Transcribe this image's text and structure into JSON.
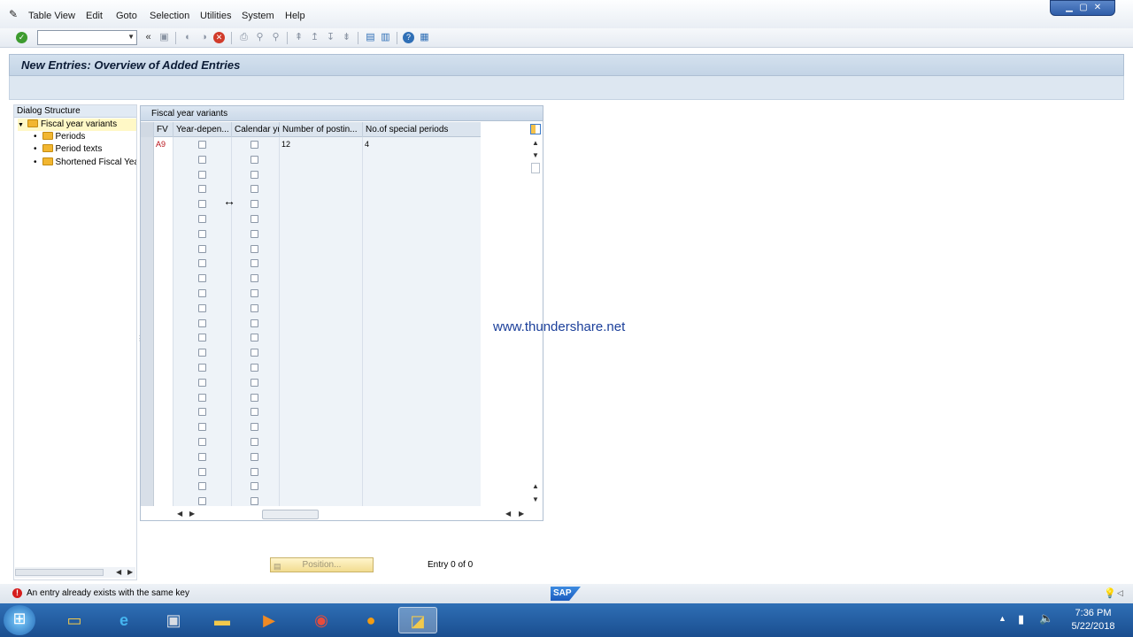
{
  "menu": {
    "items": [
      "Table View",
      "Edit",
      "Goto",
      "Selection",
      "Utilities",
      "System",
      "Help"
    ]
  },
  "title": "New Entries: Overview of Added Entries",
  "dialog_structure": {
    "header": "Dialog Structure",
    "nodes": [
      {
        "label": "Fiscal year variants",
        "selected": true
      },
      {
        "label": "Periods"
      },
      {
        "label": "Period texts"
      },
      {
        "label": "Shortened Fiscal Yea"
      }
    ]
  },
  "table": {
    "title": "Fiscal year variants",
    "columns": [
      "FV",
      "Year-depen...",
      "Calendar yr",
      "Number of postin...",
      "No.of special periods"
    ],
    "rows": [
      {
        "fv": "A9",
        "num_postings": "12",
        "special_periods": "4"
      },
      {
        "fv": "",
        "num_postings": "",
        "special_periods": ""
      },
      {
        "fv": "",
        "num_postings": "",
        "special_periods": ""
      },
      {
        "fv": "",
        "num_postings": "",
        "special_periods": ""
      },
      {
        "fv": "",
        "num_postings": "",
        "special_periods": ""
      },
      {
        "fv": "",
        "num_postings": "",
        "special_periods": ""
      },
      {
        "fv": "",
        "num_postings": "",
        "special_periods": ""
      },
      {
        "fv": "",
        "num_postings": "",
        "special_periods": ""
      },
      {
        "fv": "",
        "num_postings": "",
        "special_periods": ""
      },
      {
        "fv": "",
        "num_postings": "",
        "special_periods": ""
      },
      {
        "fv": "",
        "num_postings": "",
        "special_periods": ""
      },
      {
        "fv": "",
        "num_postings": "",
        "special_periods": ""
      },
      {
        "fv": "",
        "num_postings": "",
        "special_periods": ""
      },
      {
        "fv": "",
        "num_postings": "",
        "special_periods": ""
      },
      {
        "fv": "",
        "num_postings": "",
        "special_periods": ""
      },
      {
        "fv": "",
        "num_postings": "",
        "special_periods": ""
      },
      {
        "fv": "",
        "num_postings": "",
        "special_periods": ""
      },
      {
        "fv": "",
        "num_postings": "",
        "special_periods": ""
      },
      {
        "fv": "",
        "num_postings": "",
        "special_periods": ""
      },
      {
        "fv": "",
        "num_postings": "",
        "special_periods": ""
      },
      {
        "fv": "",
        "num_postings": "",
        "special_periods": ""
      },
      {
        "fv": "",
        "num_postings": "",
        "special_periods": ""
      },
      {
        "fv": "",
        "num_postings": "",
        "special_periods": ""
      },
      {
        "fv": "",
        "num_postings": "",
        "special_periods": ""
      },
      {
        "fv": "",
        "num_postings": "",
        "special_periods": ""
      }
    ]
  },
  "position_button": "Position...",
  "entry_text": "Entry 0 of 0",
  "watermark": "www.thundershare.net",
  "status": {
    "message": "An entry already exists with the same key",
    "type": "error",
    "logo": "SAP"
  },
  "taskbar": {
    "apps": [
      "start-orb-icon",
      "file-explorer-icon",
      "internet-explorer-icon",
      "sap-logon-icon",
      "folder-icon",
      "media-player-icon",
      "chrome-icon",
      "firefox-icon",
      "sap-gui-icon"
    ],
    "time": "7:36 PM",
    "date": "5/22/2018"
  },
  "colors": {
    "title_bg": "#c3d4e6",
    "error": "#d51d1d",
    "taskbar": "#1a4e8f"
  }
}
